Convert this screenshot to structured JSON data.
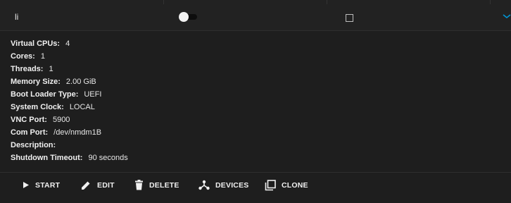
{
  "vm": {
    "name": "li",
    "autostart_enabled": false,
    "selected": false,
    "expanded": true
  },
  "details": [
    {
      "label": "Virtual CPUs:",
      "value": "4"
    },
    {
      "label": "Cores:",
      "value": "1"
    },
    {
      "label": "Threads:",
      "value": "1"
    },
    {
      "label": "Memory Size:",
      "value": "2.00 GiB"
    },
    {
      "label": "Boot Loader Type:",
      "value": "UEFI"
    },
    {
      "label": "System Clock:",
      "value": "LOCAL"
    },
    {
      "label": "VNC Port:",
      "value": "5900"
    },
    {
      "label": "Com Port:",
      "value": "/dev/nmdm1B"
    },
    {
      "label": "Description:",
      "value": ""
    },
    {
      "label": "Shutdown Timeout:",
      "value": "90 seconds"
    }
  ],
  "actions": {
    "start": {
      "label": "START",
      "icon": "play-icon"
    },
    "edit": {
      "label": "EDIT",
      "icon": "pencil-icon"
    },
    "delete": {
      "label": "DELETE",
      "icon": "trash-icon"
    },
    "devices": {
      "label": "DEVICES",
      "icon": "devices-icon"
    },
    "clone": {
      "label": "CLONE",
      "icon": "clone-icon"
    }
  },
  "colors": {
    "background": "#1e1e1e",
    "header": "#222222",
    "accent": "#0095d5",
    "text": "#e6e6e6"
  }
}
